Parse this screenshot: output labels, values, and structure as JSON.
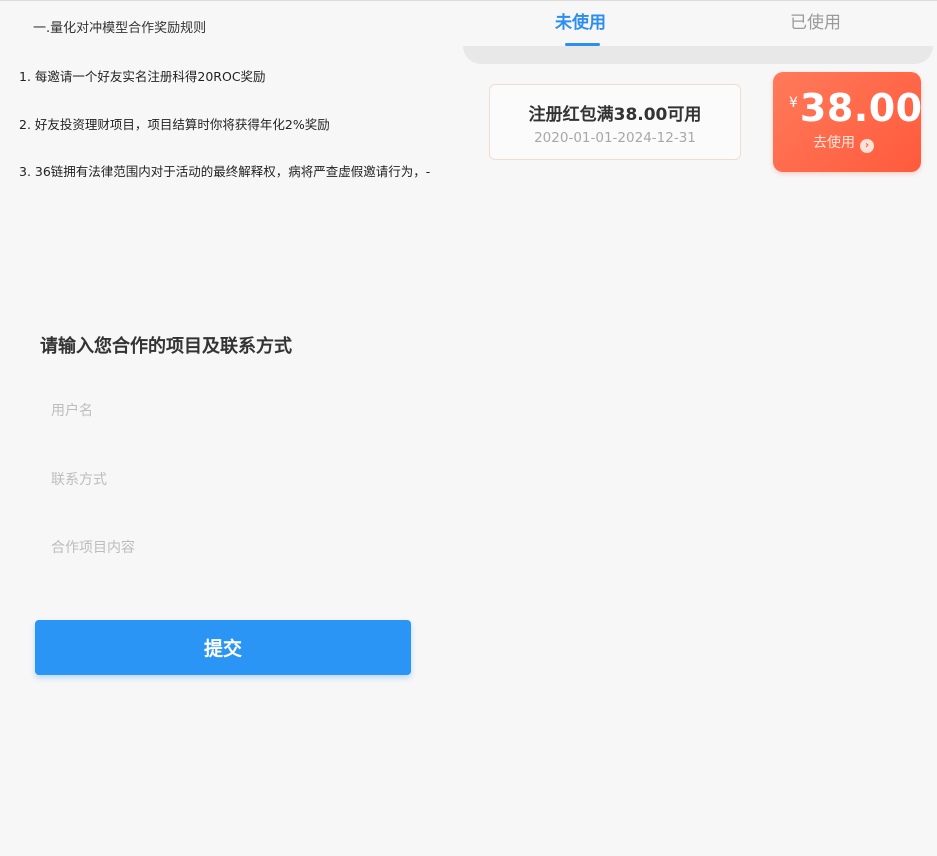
{
  "rules": {
    "title": "一.量化对冲模型合作奖励规则",
    "items": [
      "1. 每邀请一个好友实名注册科得20ROC奖励",
      "2. 好友投资理财项目，项目结算时你将获得年化2%奖励",
      "3. 36链拥有法律范围内对于活动的最终解释权，病将严查虚假邀请行为，-"
    ]
  },
  "coupons": {
    "tabs": [
      {
        "label": "未使用",
        "active": true
      },
      {
        "label": "已使用",
        "active": false
      }
    ],
    "card": {
      "name": "注册红包满38.00可用",
      "date_range": "2020-01-01-2024-12-31",
      "currency": "¥",
      "amount": "38.00",
      "use_label": "去使用",
      "use_icon": "chevron-right-circle-icon"
    },
    "colors": {
      "accent": "#2b8ef0",
      "coupon": "#ff5a3c"
    }
  },
  "form": {
    "title": "请输入您合作的项目及联系方式",
    "username_placeholder": "用户名",
    "contact_placeholder": "联系方式",
    "content_placeholder": "合作项目内容",
    "submit_label": "提交",
    "submit_color": "#2b95f5"
  }
}
